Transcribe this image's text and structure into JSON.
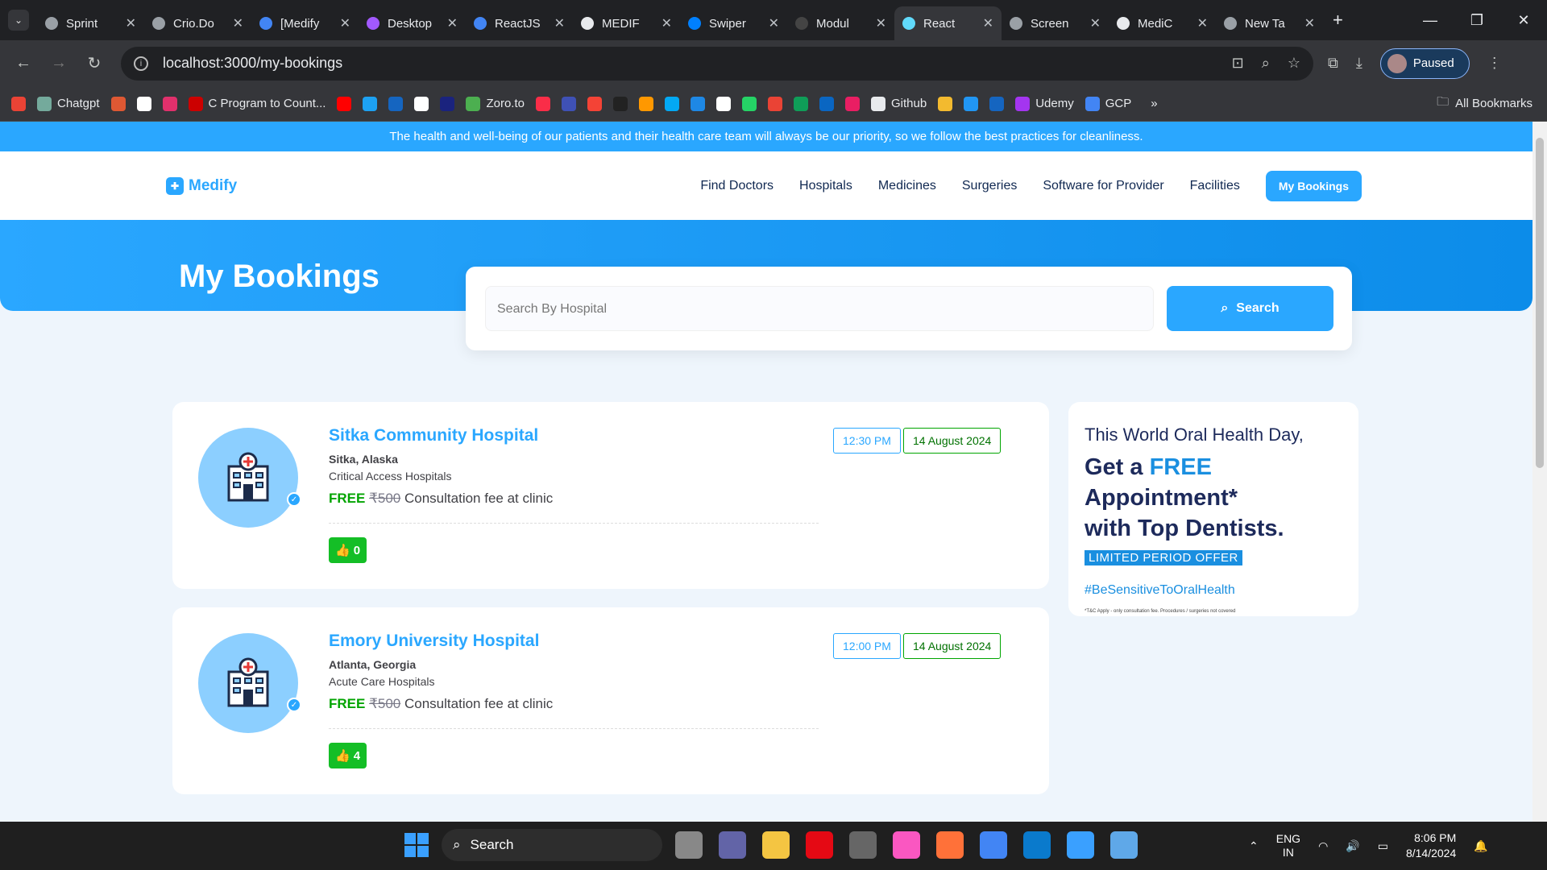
{
  "browser": {
    "tabs": [
      {
        "title": "Sprint",
        "color": "#9aa0a6"
      },
      {
        "title": "Crio.Do",
        "color": "#9aa0a6"
      },
      {
        "title": "[Medify",
        "color": "#4285f4"
      },
      {
        "title": "Desktop",
        "color": "#a259ff"
      },
      {
        "title": "ReactJS",
        "color": "#4285f4"
      },
      {
        "title": "MEDIF",
        "color": "#e8eaed"
      },
      {
        "title": "Swiper",
        "color": "#0080ff"
      },
      {
        "title": "Modul",
        "color": "#444"
      },
      {
        "title": "React",
        "color": "#61dafb"
      },
      {
        "title": "Screen",
        "color": "#9aa0a6"
      },
      {
        "title": "MediC",
        "color": "#e8eaed"
      },
      {
        "title": "New Ta",
        "color": "#9aa0a6"
      }
    ],
    "url": "localhost:3000/my-bookings",
    "profile_status": "Paused",
    "bookmarks": [
      {
        "label": "",
        "color": "#ea4335"
      },
      {
        "label": "Chatgpt",
        "color": "#74aa9c"
      },
      {
        "label": "",
        "color": "#de5833"
      },
      {
        "label": "",
        "color": "#fff"
      },
      {
        "label": "",
        "color": "#e1306c"
      },
      {
        "label": "C Program to Count...",
        "color": "#c00"
      },
      {
        "label": "",
        "color": "#f00"
      },
      {
        "label": "",
        "color": "#1da1f2"
      },
      {
        "label": "",
        "color": "#1565c0"
      },
      {
        "label": "",
        "color": "#fff"
      },
      {
        "label": "",
        "color": "#1a237e"
      },
      {
        "label": "Zoro.to",
        "color": "#4caf50"
      },
      {
        "label": "",
        "color": "#fa2d48"
      },
      {
        "label": "",
        "color": "#3f51b5"
      },
      {
        "label": "",
        "color": "#f44336"
      },
      {
        "label": "",
        "color": "#222"
      },
      {
        "label": "",
        "color": "#ff9800"
      },
      {
        "label": "",
        "color": "#03a9f4"
      },
      {
        "label": "",
        "color": "#1e88e5"
      },
      {
        "label": "",
        "color": "#fff"
      },
      {
        "label": "",
        "color": "#25d366"
      },
      {
        "label": "",
        "color": "#ea4335"
      },
      {
        "label": "",
        "color": "#0f9d58"
      },
      {
        "label": "",
        "color": "#0a66c2"
      },
      {
        "label": "",
        "color": "#e91e63"
      },
      {
        "label": "Github",
        "color": "#e8eaed"
      },
      {
        "label": "",
        "color": "#f3ba2f"
      },
      {
        "label": "",
        "color": "#2196f3"
      },
      {
        "label": "",
        "color": "#1565c0"
      },
      {
        "label": "Udemy",
        "color": "#a435f0"
      },
      {
        "label": "GCP",
        "color": "#4285f4"
      }
    ],
    "all_bookmarks": "All Bookmarks"
  },
  "site": {
    "notice": "The health and well-being of our patients and their health care team will always be our priority, so we follow the best practices for cleanliness.",
    "logo": "Medify",
    "nav": [
      "Find Doctors",
      "Hospitals",
      "Medicines",
      "Surgeries",
      "Software for Provider",
      "Facilities"
    ],
    "nav_cta": "My Bookings",
    "page_title": "My Bookings",
    "search_placeholder": "Search By Hospital",
    "search_button": "Search",
    "bookings": [
      {
        "name": "Sitka Community Hospital",
        "location": "Sitka, Alaska",
        "type": "Critical Access Hospitals",
        "free": "Free",
        "fee": "₹500",
        "fee_text": "Consultation fee at clinic",
        "likes": "0",
        "time": "12:30 PM",
        "date": "14 August 2024"
      },
      {
        "name": "Emory University Hospital",
        "location": "Atlanta, Georgia",
        "type": "Acute Care Hospitals",
        "free": "Free",
        "fee": "₹500",
        "fee_text": "Consultation fee at clinic",
        "likes": "4",
        "time": "12:00 PM",
        "date": "14 August 2024"
      }
    ],
    "ad": {
      "line1": "This World Oral Health Day,",
      "line2a": "Get a ",
      "line2b": "FREE",
      "line2c": " Appointment*",
      "line3": "with Top Dentists.",
      "badge": "LIMITED PERIOD OFFER",
      "hashtag": "#BeSensitiveToOralHealth",
      "terms": "*T&C Apply - only consultation fee. Procedures / surgeries not covered"
    }
  },
  "taskbar": {
    "search": "Search",
    "lang1": "ENG",
    "lang2": "IN",
    "time": "8:06 PM",
    "date": "8/14/2024"
  }
}
